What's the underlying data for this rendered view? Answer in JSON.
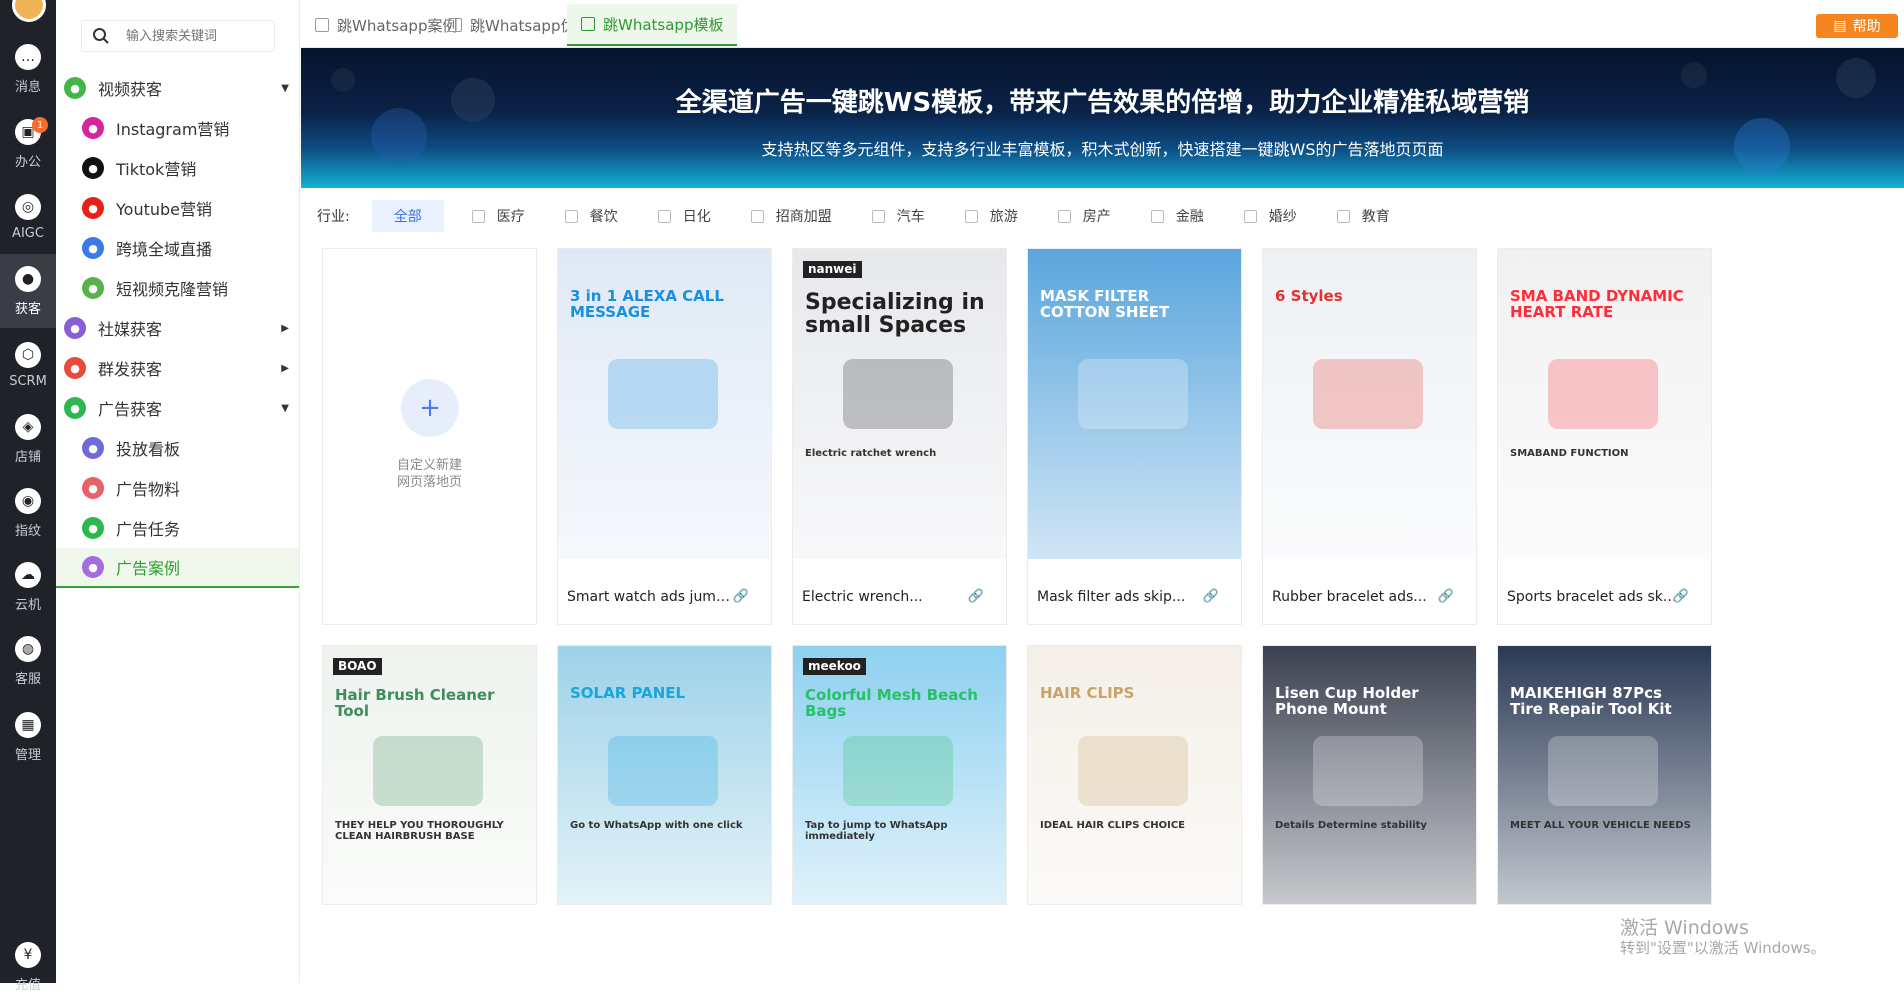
{
  "rail": {
    "items": [
      {
        "label": "消息",
        "icon": "chat-icon"
      },
      {
        "label": "办公",
        "icon": "office-icon",
        "badge": "1"
      },
      {
        "label": "AIGC",
        "icon": "ai-icon"
      },
      {
        "label": "获客",
        "icon": "customer-icon"
      },
      {
        "label": "SCRM",
        "icon": "scrm-icon"
      },
      {
        "label": "店铺",
        "icon": "shop-icon"
      },
      {
        "label": "指纹",
        "icon": "fingerprint-icon"
      },
      {
        "label": "云机",
        "icon": "cloud-phone-icon"
      },
      {
        "label": "客服",
        "icon": "support-icon"
      },
      {
        "label": "管理",
        "icon": "grid-icon"
      },
      {
        "label": "充值",
        "icon": "yen-icon"
      }
    ]
  },
  "sidebar": {
    "search_placeholder": "输入搜索关键词",
    "items": [
      {
        "label": "视频获客",
        "color": "#43b549"
      },
      {
        "label": "Instagram营销",
        "color": "#d6249f"
      },
      {
        "label": "Tiktok营销",
        "color": "#111111"
      },
      {
        "label": "Youtube营销",
        "color": "#e62117"
      },
      {
        "label": "跨境全域直播",
        "color": "#3b7be8"
      },
      {
        "label": "短视频克隆营销",
        "color": "#57b24c"
      },
      {
        "label": "社媒获客",
        "color": "#8a5cd6"
      },
      {
        "label": "群发获客",
        "color": "#e84a3c"
      },
      {
        "label": "广告获客",
        "color": "#2db84d"
      },
      {
        "label": "投放看板",
        "color": "#6f6ad9"
      },
      {
        "label": "广告物料",
        "color": "#e86068"
      },
      {
        "label": "广告任务",
        "color": "#2db84d"
      },
      {
        "label": "广告案例",
        "color": "#a56be0"
      }
    ]
  },
  "tabs": [
    {
      "label": "跳Whatsapp案例"
    },
    {
      "label": "跳Whatsapp优势"
    },
    {
      "label": "跳Whatsapp模板"
    }
  ],
  "help_label": "帮助",
  "banner": {
    "title": "全渠道广告一键跳WS模板，带来广告效果的倍增，助力企业精准私域营销",
    "subtitle": "支持热区等多元组件，支持多行业丰富模板，积木式创新，快速搭建一键跳WS的广告落地页页面"
  },
  "filter": {
    "label": "行业:",
    "options": [
      "全部",
      "医疗",
      "餐饮",
      "日化",
      "招商加盟",
      "汽车",
      "旅游",
      "房产",
      "金融",
      "婚纱",
      "教育"
    ]
  },
  "new_card": {
    "line1": "自定义新建",
    "line2": "网页落地页"
  },
  "cards": [
    {
      "caption": "Smart watch ads jump...",
      "headline": "3 in 1 ALEXA CALL MESSAGE",
      "color": "#dfe9f5",
      "accent": "#1a8fe0"
    },
    {
      "caption": "Electric wrench...",
      "headline": "Specializing in small Spaces",
      "sub": "Electric ratchet wrench",
      "brand": "nanwei",
      "color": "#e6e8ec",
      "accent": "#222222"
    },
    {
      "caption": "Mask filter ads skip...",
      "headline": "MASK FILTER COTTON SHEET",
      "color": "#5aa6dd",
      "accent": "#ffffff"
    },
    {
      "caption": "Rubber bracelet ads...",
      "headline": "6 Styles",
      "color": "#eef1f4",
      "accent": "#e2322a"
    },
    {
      "caption": "Sports bracelet ads sk...",
      "headline": "SMA BAND DYNAMIC HEART RATE",
      "sub": "SMABAND FUNCTION",
      "color": "#f1f1f1",
      "accent": "#ff2d3a"
    },
    {
      "caption": "",
      "headline": "Hair Brush Cleaner Tool",
      "sub": "THEY HELP YOU THOROUGHLY CLEAN HAIRBRUSH BASE",
      "brand": "BOAO",
      "color": "#eef3ee",
      "accent": "#3e8d5a"
    },
    {
      "caption": "",
      "headline": "SOLAR PANEL",
      "sub": "Go to WhatsApp with one click",
      "color": "#9ed2e8",
      "accent": "#19a5e0"
    },
    {
      "caption": "",
      "headline": "Colorful Mesh Beach Bags",
      "sub": "Tap to jump to WhatsApp immediately",
      "brand": "meekoo",
      "color": "#8fd0f0",
      "accent": "#27c166"
    },
    {
      "caption": "",
      "headline": "HAIR CLIPS",
      "sub": "IDEAL HAIR CLIPS CHOICE",
      "color": "#f4efe8",
      "accent": "#c9a36a"
    },
    {
      "caption": "",
      "headline": "Lisen Cup Holder Phone Mount",
      "sub": "Details Determine stability",
      "color": "#3b4150",
      "accent": "#ffffff"
    },
    {
      "caption": "",
      "headline": "MAIKEHIGH 87Pcs Tire Repair Tool Kit",
      "sub": "MEET ALL YOUR VEHICLE NEEDS",
      "color": "#2b3a55",
      "accent": "#ffffff"
    }
  ],
  "watermark": {
    "line1": "激活 Windows",
    "line2": "转到\"设置\"以激活 Windows。"
  }
}
